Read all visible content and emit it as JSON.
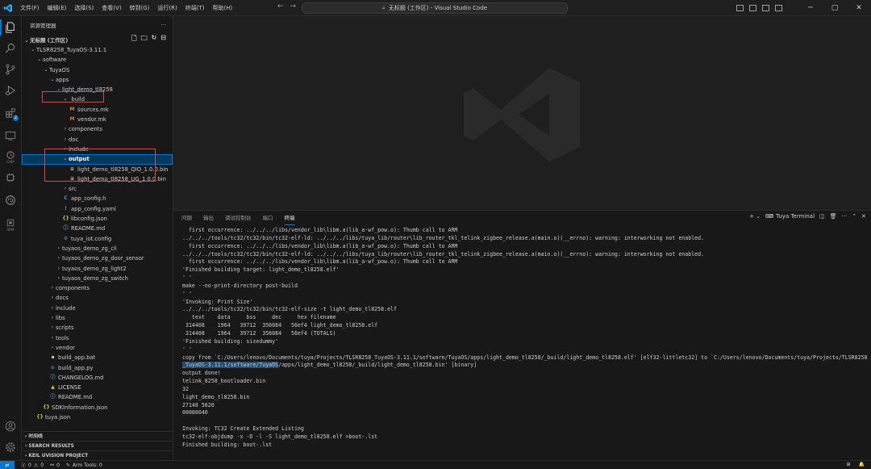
{
  "titlebar": {
    "menu": [
      "文件(F)",
      "编辑(E)",
      "选择(S)",
      "查看(V)",
      "转到(G)",
      "运行(R)",
      "终端(T)",
      "帮助(H)"
    ],
    "search_text": "无标题 (工作区) - Visual Studio Code",
    "colors": {
      "accent": "#0078d4",
      "logo": "#23a9f2"
    }
  },
  "activity_bar": {
    "icons": [
      "files-icon",
      "search-icon",
      "source-control-icon",
      "run-debug-icon",
      "extensions-icon",
      "remote-explorer-icon",
      "chip-icon",
      "chip-tools-icon",
      "arm-icon",
      "accounts-icon",
      "settings-icon"
    ],
    "extensions_badge": "2",
    "chip_label": "CHIP",
    "arm_label": "ARM"
  },
  "sidebar": {
    "title": "资源管理器",
    "more": "···",
    "workspace_label": "无标题 (工作区)",
    "tree": [
      {
        "label": "TLSR8258_TuyaOS-3.11.1",
        "depth": 1,
        "kind": "folder-open"
      },
      {
        "label": "software",
        "depth": 2,
        "kind": "folder-open"
      },
      {
        "label": "TuyaOS",
        "depth": 3,
        "kind": "folder-open"
      },
      {
        "label": "apps",
        "depth": 4,
        "kind": "folder-open"
      },
      {
        "label": "light_demo_tl8258",
        "depth": 5,
        "kind": "folder-open"
      },
      {
        "label": "_build",
        "depth": 6,
        "kind": "folder-open"
      },
      {
        "label": "sources.mk",
        "depth": 7,
        "kind": "mk"
      },
      {
        "label": "vendor.mk",
        "depth": 7,
        "kind": "mk"
      },
      {
        "label": "components",
        "depth": 6,
        "kind": "folder"
      },
      {
        "label": "doc",
        "depth": 6,
        "kind": "folder"
      },
      {
        "label": "include",
        "depth": 6,
        "kind": "folder"
      },
      {
        "label": "output",
        "depth": 6,
        "kind": "folder-open",
        "selected": true
      },
      {
        "label": "light_demo_tl8258_QIO_1.0.0.bin",
        "depth": 7,
        "kind": "bin"
      },
      {
        "label": "light_demo_tl8258_UG_1.0.0.bin",
        "depth": 7,
        "kind": "bin"
      },
      {
        "label": "src",
        "depth": 6,
        "kind": "folder"
      },
      {
        "label": "app_config.h",
        "depth": 6,
        "kind": "c"
      },
      {
        "label": "app_config.yaml",
        "depth": 6,
        "kind": "yaml"
      },
      {
        "label": "libconfig.json",
        "depth": 6,
        "kind": "json"
      },
      {
        "label": "README.md",
        "depth": 6,
        "kind": "md"
      },
      {
        "label": "tuya_iot.config",
        "depth": 6,
        "kind": "config"
      },
      {
        "label": "tuyaos_demo_zg_cli",
        "depth": 5,
        "kind": "folder"
      },
      {
        "label": "tuyaos_demo_zg_door_sensor",
        "depth": 5,
        "kind": "folder"
      },
      {
        "label": "tuyaos_demo_zg_light2",
        "depth": 5,
        "kind": "folder"
      },
      {
        "label": "tuyaos_demo_zg_switch",
        "depth": 5,
        "kind": "folder"
      },
      {
        "label": "components",
        "depth": 4,
        "kind": "folder"
      },
      {
        "label": "docs",
        "depth": 4,
        "kind": "folder"
      },
      {
        "label": "include",
        "depth": 4,
        "kind": "folder"
      },
      {
        "label": "libs",
        "depth": 4,
        "kind": "folder"
      },
      {
        "label": "scripts",
        "depth": 4,
        "kind": "folder"
      },
      {
        "label": "tools",
        "depth": 4,
        "kind": "folder"
      },
      {
        "label": "vendor",
        "depth": 4,
        "kind": "folder"
      },
      {
        "label": "build_app.bat",
        "depth": 4,
        "kind": "bat"
      },
      {
        "label": "build_app.py",
        "depth": 4,
        "kind": "py"
      },
      {
        "label": "CHANGELOG.md",
        "depth": 4,
        "kind": "md"
      },
      {
        "label": "LICENSE",
        "depth": 4,
        "kind": "license"
      },
      {
        "label": "README.md",
        "depth": 4,
        "kind": "md"
      },
      {
        "label": "SDKInformation.json",
        "depth": 3,
        "kind": "json"
      },
      {
        "label": "tuya.json",
        "depth": 2,
        "kind": "json"
      }
    ],
    "bottom_sections": [
      "时间线",
      "SEARCH RESULTS",
      "KEIL UVISION PROJECT"
    ]
  },
  "panel": {
    "tabs": [
      "问题",
      "输出",
      "调试控制台",
      "端口",
      "终端"
    ],
    "active_tab": "终端",
    "terminal_name": "Tuya Terminal",
    "lines": [
      "  first occurrence: ../../../libs/vendor_lib\\libm.a(lib_a-wf_pow.o): Thumb call to ARM",
      "../../../tools/tc32/tc32/bin/tc32-elf-ld: ../../../libs/tuya_lib/router\\lib_router_tkl_telink_zigbee_release.a(main.o)(__errno): warning: interworking not enabled.",
      "  first occurrence: ../../../libs/vendor_lib\\libm.a(lib_a-wf_pow.o): Thumb call to ARM",
      "../../../tools/tc32/tc32/bin/tc32-elf-ld: ../../../libs/tuya_lib/router\\lib_router_tkl_telink_zigbee_release.a(main.o)(__errno): warning: interworking not enabled.",
      "  first occurrence: ../../../libs/vendor_lib\\libm.a(lib_a-wf_pow.o): Thumb call to ARM",
      "'Finished building target: light_demo_tl8258.elf'",
      "' '",
      "make --no-print-directory post-build",
      "' '",
      "'Invoking: Print Size'",
      "../../../tools/tc32/tc32/bin/tc32-elf-size -t light_demo_tl8258.elf",
      "   text    data     bss     dec     hex filename",
      " 314408    1964   39712  356084   56ef4 light_demo_tl8258.elf",
      " 314408    1964   39712  356084   56ef4 (TOTALS)",
      "'Finished building: sizedummy'",
      "' '",
      "copy from `C:/Users/lenovo/Documents/tuya/Projects/TLSR8258_TuyaOS-3.11.1/software/TuyaOS/apps/light_demo_tl8258/_build/light_demo_tl8258.elf' [elf32-littletc32] to `C:/Users/lenovo/Documents/tuya/Projects/TLSR8258",
      "_TuyaOS-3.11.1/software/TuyaOS/apps/light_demo_tl8258/_build/light_demo_tl8258.bin' [binary]",
      "output done!",
      "telink_8258_bootloader.bin",
      "32",
      "light_demo_tl8258.bin",
      "27148 5620",
      "00000040",
      "",
      "Invoking: TC32 Create Extended Listing",
      "tc32-elf-objdump -x -D -l -S light_demo_tl8258.elf >boot-.lst",
      "Finished building: boot-.lst"
    ]
  },
  "statusbar": {
    "errors": "0",
    "warnings": "0",
    "ports": "0",
    "arm_tools": "Arm Tools: 0"
  }
}
